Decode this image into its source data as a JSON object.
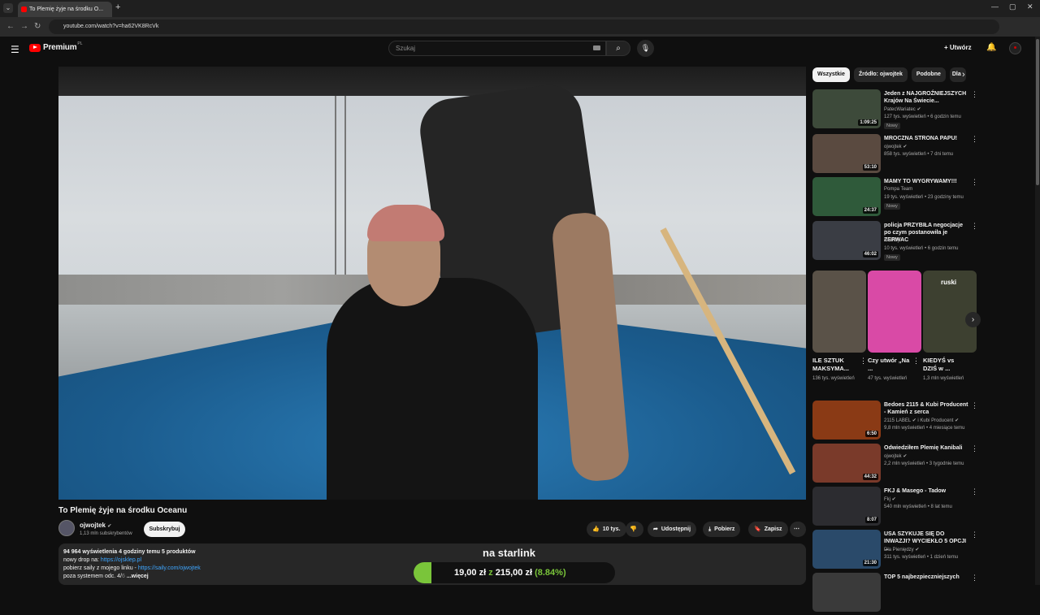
{
  "browser": {
    "tab_title": "To Plemię żyje na środku O...",
    "url": "youtube.com/watch?v=ha62VK8RcVk"
  },
  "header": {
    "logo_text": "Premium",
    "logo_region": "PL",
    "search_placeholder": "Szukaj",
    "create_label": "Utwórz"
  },
  "video": {
    "title": "To Plemię żyje na środku Oceanu",
    "channel": "ojwojtek",
    "subscribers": "1,13 mln subskrybentów",
    "subscribe_label": "Subskrybuj",
    "likes": "10 tys.",
    "share_label": "Udostępnij",
    "download_label": "Pobierz",
    "save_label": "Zapisz"
  },
  "description": {
    "meta": "94 964 wyświetlenia  4 godziny temu  5 produktów",
    "line1_text": "nowy drop na: ",
    "line1_link": "https://ojsklep.pl",
    "line2_text": "pobierz saily z mojego linku - ",
    "line2_link": "https://saily.com/ojwojtek",
    "line3_text": "poza systemem odc. 4/",
    "line3_faded": "6",
    "more_label": "...więcej"
  },
  "promo": {
    "title": "na starlink",
    "text_prefix": "19,00 zł",
    "text_z": "z",
    "text_target": "215,00 zł",
    "text_percent": "(8.84%)",
    "progress_fraction": 0.0884,
    "accent": "#7ac53a"
  },
  "chips": [
    "Wszystkie",
    "Źródło: ojwojtek",
    "Podobne",
    "Dla"
  ],
  "recommendations": [
    {
      "title": "Jeden z NAJGROŹNIEJSZYCH Krajów Na Świecie...",
      "channel": "PatecWariatec",
      "verified": true,
      "stats": "127 tys. wyświetleń • 6 godzin temu",
      "badge": "Nowy",
      "duration": "1:09:25",
      "thumb_color": "#3d4a3a"
    },
    {
      "title": "MROCZNA STRONA PAPU!",
      "channel": "ojwojtek",
      "verified": true,
      "stats": "858 tys. wyświetleń • 7 dni temu",
      "badge": "",
      "duration": "53:10",
      "thumb_color": "#5a4a40"
    },
    {
      "title": "MAMY TO WYGRYWAMY!!!",
      "channel": "Pompa Team",
      "verified": false,
      "stats": "19 tys. wyświetleń • 23 godziny temu",
      "badge": "Nowy",
      "duration": "24:37",
      "thumb_color": "#2f5a3a"
    },
    {
      "title": "policja PRZYBIŁA negocjacje po czym postanowiła je ZERWAC",
      "channel": "Grendy",
      "verified": false,
      "stats": "10 tys. wyświetleń • 6 godzin temu",
      "badge": "Nowy",
      "duration": "46:02",
      "thumb_color": "#3a3d44"
    },
    {
      "title": "Bedoes 2115 & Kubi Producent - Kamień z serca",
      "channel": "2115 LABEL",
      "verified": true,
      "channel2": "i Kubi Producent",
      "stats": "9,8 mln wyświetleń • 4 miesiące temu",
      "badge": "",
      "duration": "6:50",
      "thumb_color": "#8a3a15"
    },
    {
      "title": "Odwiedziłem Plemię Kanibali",
      "channel": "ojwojtek",
      "verified": true,
      "stats": "2,2 mln wyświetleń • 3 tygodnie temu",
      "badge": "",
      "duration": "44:32",
      "thumb_color": "#7a3a2a"
    },
    {
      "title": "FKJ & Masego - Tadow",
      "channel": "Fkj",
      "verified": true,
      "stats": "540 mln wyświetleń • 8 lat temu",
      "badge": "",
      "duration": "8:07",
      "thumb_color": "#2c2c30"
    },
    {
      "title": "USA SZYKUJE SIĘ DO INWAZJI? WYCIEKŁO 5 OPCJI ...",
      "channel": "Dla Pieniędzy",
      "verified": true,
      "stats": "311 tys. wyświetleń • 1 dzień temu",
      "badge": "",
      "duration": "21:30",
      "thumb_color": "#2a4a6a"
    },
    {
      "title": "TOP 5 najbezpieczniejszych",
      "channel": "",
      "verified": false,
      "stats": "",
      "badge": "",
      "duration": "",
      "thumb_color": "#3a3a3a"
    }
  ],
  "shorts": [
    {
      "title": "ILE SZTUK MAKSYMA...",
      "views": "136 tys. wyświetleń",
      "thumb_color": "#5a5248",
      "overlay": ""
    },
    {
      "title": "Czy utwór „Na ...",
      "views": "47 tys. wyświetleń",
      "thumb_color": "#d94aa6",
      "overlay": ""
    },
    {
      "title": "KIEDYŚ vs DZIŚ w ...",
      "views": "1,3 mln wyświetleń",
      "thumb_color": "#3d4030",
      "overlay": "ruski"
    }
  ]
}
